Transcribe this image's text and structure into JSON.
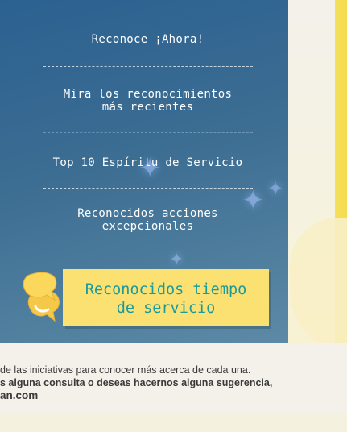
{
  "menu": {
    "items": [
      {
        "label": "Reconoce ¡Ahora!"
      },
      {
        "label_line1": "Mira los reconocimientos",
        "label_line2": "más recientes"
      },
      {
        "label": "Top 10 Espíritu de Servicio"
      },
      {
        "label_line1": "Reconocidos acciones",
        "label_line2": "excepcionales"
      }
    ]
  },
  "banner": {
    "line1": "Reconocidos tiempo",
    "line2": "de servicio"
  },
  "footer": {
    "line1": "de las iniciativas para conocer más acerca de cada una.",
    "line2": "s alguna consulta o deseas hacernos alguna sugerencia,",
    "line3": "an.com"
  },
  "colors": {
    "sidebar_top": "#2b6191",
    "banner_bg": "#fbe072",
    "banner_text": "#1b9a9a",
    "accent_yellow": "#f4dc4e"
  },
  "icons": {
    "banner": "speech-bubbles-icon"
  }
}
